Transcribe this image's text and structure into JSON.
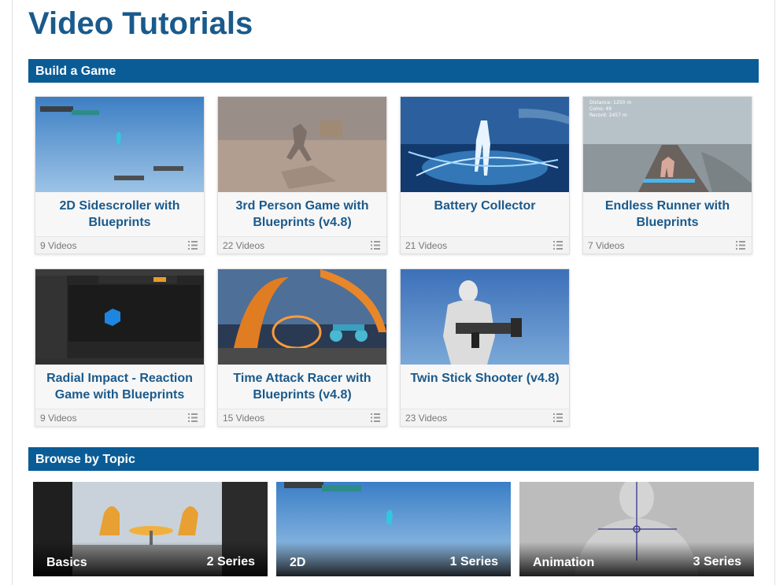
{
  "page": {
    "title": "Video Tutorials"
  },
  "sections": {
    "build_game": {
      "label": "Build a Game"
    },
    "browse_topic": {
      "label": "Browse by Topic"
    }
  },
  "cards": [
    {
      "title": "2D Sidescroller with Blueprints",
      "count": "9 Videos",
      "thumb": "sidescroller-thumbnail"
    },
    {
      "title": "3rd Person Game with Blueprints (v4.8)",
      "count": "22 Videos",
      "thumb": "third-person-thumbnail"
    },
    {
      "title": "Battery Collector",
      "count": "21 Videos",
      "thumb": "battery-collector-thumbnail"
    },
    {
      "title": "Endless Runner with Blueprints",
      "count": "7 Videos",
      "thumb": "endless-runner-thumbnail",
      "overlay": [
        "Distance: 1250 m",
        "Coins: 49",
        "Record: 2457 m"
      ]
    },
    {
      "title": "Radial Impact - Reaction Game with Blueprints",
      "count": "9 Videos",
      "thumb": "editor-thumbnail"
    },
    {
      "title": "Time Attack Racer with Blueprints (v4.8)",
      "count": "15 Videos",
      "thumb": "racer-thumbnail"
    },
    {
      "title": "Twin Stick Shooter (v4.8)",
      "count": "23 Videos",
      "thumb": "shooter-thumbnail"
    }
  ],
  "topics": [
    {
      "name": "Basics",
      "series": "2 Series"
    },
    {
      "name": "2D",
      "series": "1 Series"
    },
    {
      "name": "Animation",
      "series": "3 Series"
    }
  ],
  "icons": {
    "card_footer": "list-icon"
  },
  "colors": {
    "title_blue": "#1a5a8c",
    "section_bar": "#0a5c96"
  }
}
